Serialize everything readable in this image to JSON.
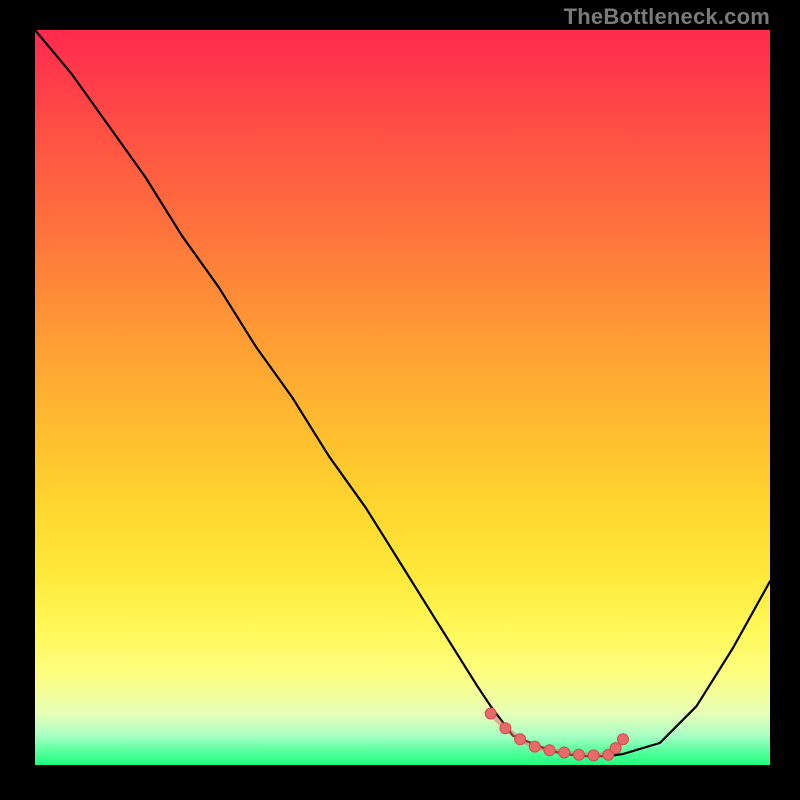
{
  "watermark": "TheBottleneck.com",
  "colors": {
    "frame": "#000000",
    "curve_stroke": "#000000",
    "marker_fill": "#e96a6a",
    "marker_stroke": "#cc4e4e"
  },
  "chart_data": {
    "type": "line",
    "title": "",
    "xlabel": "",
    "ylabel": "",
    "xlim": [
      0,
      100
    ],
    "ylim": [
      0,
      100
    ],
    "grid": false,
    "legend": false,
    "x": [
      0,
      5,
      10,
      15,
      20,
      25,
      30,
      35,
      40,
      45,
      50,
      55,
      60,
      62,
      65,
      70,
      72,
      75,
      78,
      80,
      85,
      90,
      95,
      100
    ],
    "y_percent": [
      100,
      94,
      87,
      80,
      72,
      65,
      57,
      50,
      42,
      35,
      27,
      19,
      11,
      8,
      4,
      2,
      1.5,
      1.2,
      1.2,
      1.5,
      3,
      8,
      16,
      25
    ],
    "flat_segment": {
      "x_start": 62,
      "x_end": 80,
      "markers_x": [
        62,
        64,
        66,
        68,
        70,
        72,
        74,
        76,
        78,
        79,
        80
      ],
      "markers_y_percent": [
        7,
        5,
        3.5,
        2.5,
        2,
        1.7,
        1.4,
        1.3,
        1.4,
        2.3,
        3.5
      ]
    }
  }
}
